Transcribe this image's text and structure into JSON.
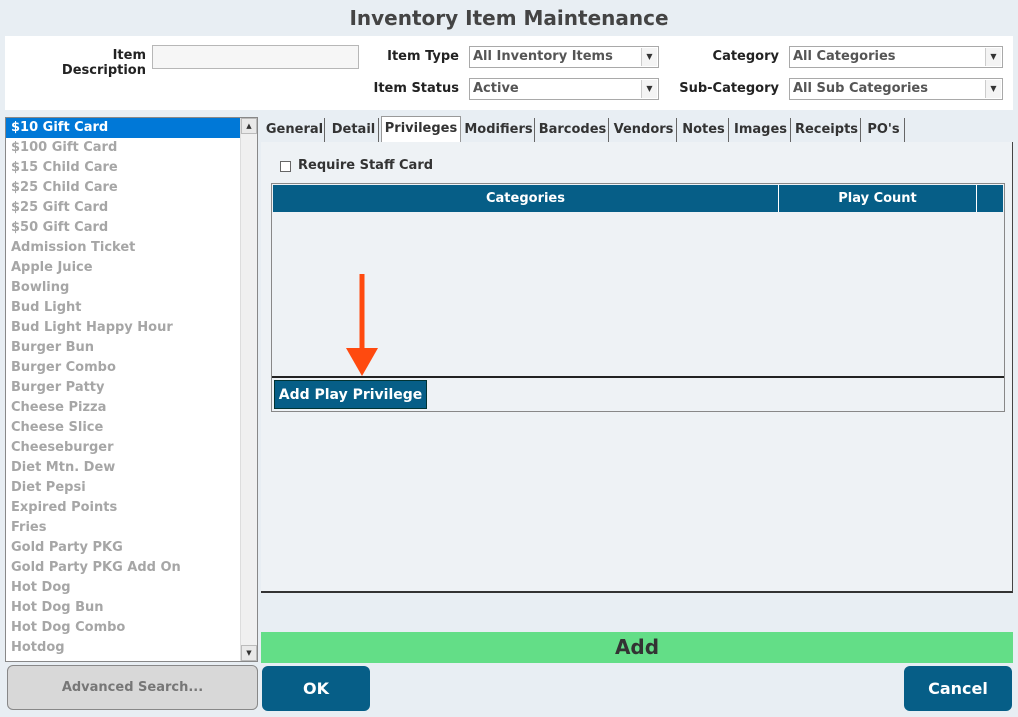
{
  "window": {
    "title": "Inventory Item Maintenance"
  },
  "filters": {
    "item_description_label": "Item Description",
    "item_description_value": "",
    "item_type_label": "Item Type",
    "item_type_value": "All Inventory Items",
    "item_status_label": "Item Status",
    "item_status_value": "Active",
    "category_label": "Category",
    "category_value": "All Categories",
    "subcategory_label": "Sub-Category",
    "subcategory_value": "All Sub Categories"
  },
  "items": [
    "$10 Gift Card",
    "$100 Gift Card",
    "$15 Child Care",
    "$25 Child Care",
    "$25 Gift Card",
    "$50 Gift Card",
    "Admission Ticket",
    "Apple Juice",
    "Bowling",
    "Bud Light",
    "Bud Light Happy Hour",
    "Burger Bun",
    "Burger Combo",
    "Burger Patty",
    "Cheese Pizza",
    "Cheese Slice",
    "Cheeseburger",
    "Diet Mtn. Dew",
    "Diet Pepsi",
    "Expired Points",
    "Fries",
    "Gold Party PKG",
    "Gold Party PKG Add On",
    "Hot Dog",
    "Hot Dog Bun",
    "Hot Dog Combo",
    "Hotdog"
  ],
  "selected_item_index": 0,
  "tabs": [
    {
      "label": "General"
    },
    {
      "label": "Detail"
    },
    {
      "label": "Privileges",
      "active": true
    },
    {
      "label": "Modifiers"
    },
    {
      "label": "Barcodes"
    },
    {
      "label": "Vendors"
    },
    {
      "label": "Notes"
    },
    {
      "label": "Images"
    },
    {
      "label": "Receipts"
    },
    {
      "label": "PO's"
    }
  ],
  "privileges": {
    "require_staff_card_label": "Require Staff Card",
    "require_staff_card_checked": false,
    "columns": [
      "Categories",
      "Play Count"
    ],
    "add_play_privilege_label": "Add Play Privilege"
  },
  "buttons": {
    "add": "Add",
    "advanced_search": "Advanced Search...",
    "ok": "OK",
    "cancel": "Cancel"
  },
  "colors": {
    "header_blue": "#065e87",
    "add_green": "#63de87",
    "selection_blue": "#0078d7",
    "arrow_orange": "#ff4a0f"
  }
}
